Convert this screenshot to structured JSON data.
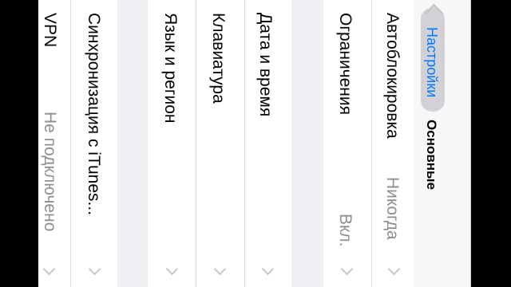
{
  "nav": {
    "back_label": "Настройки",
    "title": "Основные"
  },
  "rows": {
    "autolock": {
      "label": "Автоблокировка",
      "value": "Никогда"
    },
    "restrictions": {
      "label": "Ограничения",
      "value": "Вкл."
    },
    "datetime": {
      "label": "Дата и время"
    },
    "keyboard": {
      "label": "Клавиатура"
    },
    "language": {
      "label": "Язык и регион"
    },
    "itunes": {
      "label": "Синхронизация с iTunes..."
    },
    "vpn": {
      "label": "VPN",
      "value": "Не подключено"
    }
  },
  "colors": {
    "accent": "#007aff",
    "secondary_text": "#8e8e93",
    "group_background": "#efeff4"
  },
  "icons": [
    "chevron-left-icon",
    "chevron-right-icon"
  ]
}
